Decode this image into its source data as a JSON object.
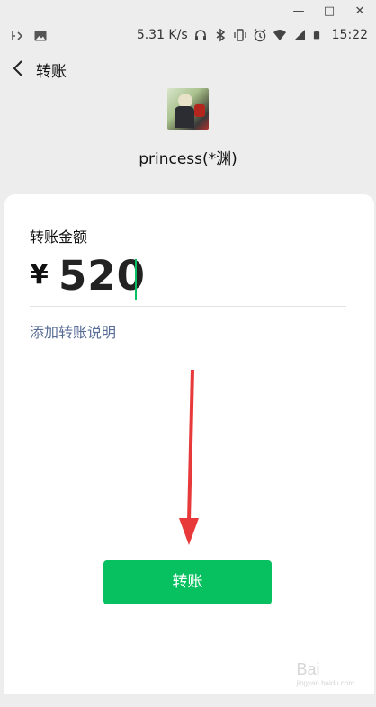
{
  "window": {
    "minimize": "—",
    "maximize": "□",
    "close": "✕"
  },
  "status_bar": {
    "speed": "5.31 K/s",
    "time": "15:22",
    "icons": [
      "signal-indicator-icon",
      "image-icon",
      "headphones-icon",
      "bluetooth-icon",
      "vibrate-icon",
      "alarm-icon",
      "wifi-icon",
      "cell-signal-icon",
      "battery-icon"
    ]
  },
  "nav": {
    "title": "转账"
  },
  "recipient": {
    "name": "princess(*渊)"
  },
  "form": {
    "amount_label": "转账金额",
    "currency_symbol": "¥",
    "amount": "520",
    "add_note": "添加转账说明",
    "submit_label": "转账"
  },
  "colors": {
    "accent_green": "#07c160",
    "link_blue": "#576b95",
    "annotation_red": "#e8393a"
  },
  "watermark": {
    "brand": "Bai",
    "sub": "jingyan.baidu.com"
  }
}
